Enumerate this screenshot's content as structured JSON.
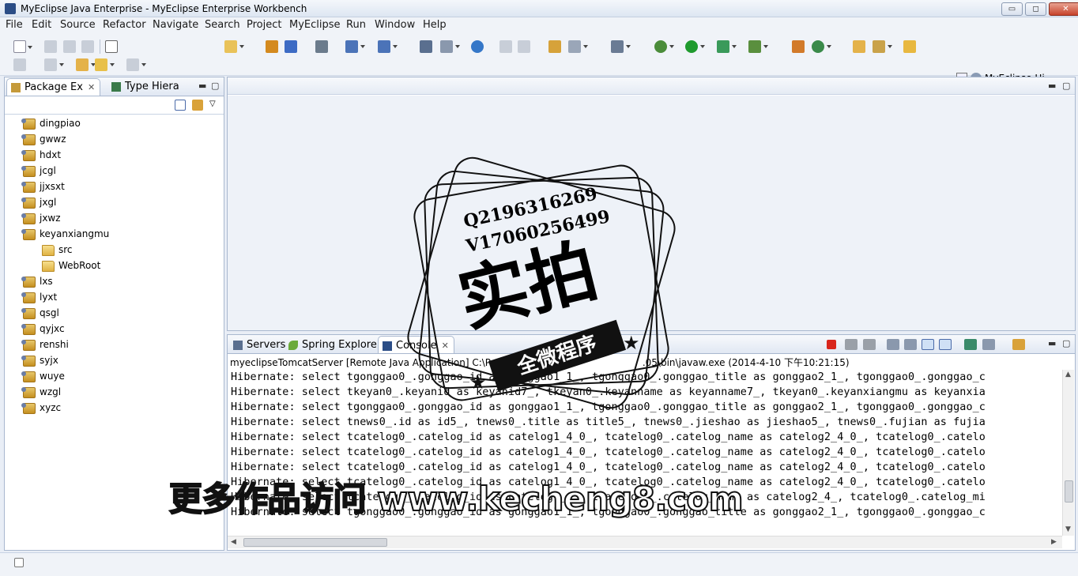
{
  "window": {
    "title": "MyEclipse Java Enterprise - MyEclipse Enterprise Workbench",
    "buttons": {
      "minimize": "▭",
      "maximize": "◻",
      "close": "✕"
    }
  },
  "menu": [
    "File",
    "Edit",
    "Source",
    "Refactor",
    "Navigate",
    "Search",
    "Project",
    "MyEclipse",
    "Run",
    "Window",
    "Help"
  ],
  "perspective": {
    "label": "MyEclipse Hi..."
  },
  "package_explorer": {
    "tab_label": "Package Ex",
    "other_tab_label": "Type Hiera",
    "items": [
      {
        "label": "dingpiao",
        "kind": "project"
      },
      {
        "label": "gwwz",
        "kind": "project"
      },
      {
        "label": "hdxt",
        "kind": "project"
      },
      {
        "label": "jcgl",
        "kind": "project"
      },
      {
        "label": "jjxsxt",
        "kind": "project"
      },
      {
        "label": "jxgl",
        "kind": "project"
      },
      {
        "label": "jxwz",
        "kind": "project"
      },
      {
        "label": "keyanxiangmu",
        "kind": "project"
      },
      {
        "label": "src",
        "kind": "folder"
      },
      {
        "label": "WebRoot",
        "kind": "folder"
      },
      {
        "label": "lxs",
        "kind": "project"
      },
      {
        "label": "lyxt",
        "kind": "project"
      },
      {
        "label": "qsgl",
        "kind": "project"
      },
      {
        "label": "qyjxc",
        "kind": "project"
      },
      {
        "label": "renshi",
        "kind": "project"
      },
      {
        "label": "syjx",
        "kind": "project"
      },
      {
        "label": "wuye",
        "kind": "project"
      },
      {
        "label": "wzgl",
        "kind": "project"
      },
      {
        "label": "xyzc",
        "kind": "project"
      }
    ]
  },
  "console": {
    "tabs": [
      {
        "label": "Servers",
        "icon": "servers-icon"
      },
      {
        "label": "Spring Explorer",
        "icon": "spring-leaf-icon"
      },
      {
        "label": "Console",
        "icon": "console-icon"
      }
    ],
    "launch_info": "myeclipseTomcatServer [Remote Java Application] C:\\Pro",
    "launch_info_tail": ".05\\bin\\javaw.exe (2014-4-10 下午10:21:15)",
    "lines": [
      "Hibernate: select tgonggao0_.gonggao_id as gonggao1_1_, tgonggao0_.gonggao_title as gonggao2_1_, tgonggao0_.gonggao_c",
      "Hibernate: select tkeyan0_.keyanid as keyanid7_, tkeyan0_.keyanname as keyanname7_, tkeyan0_.keyanxiangmu as keyanxia",
      "Hibernate: select tgonggao0_.gonggao_id as gonggao1_1_, tgonggao0_.gonggao_title as gonggao2_1_, tgonggao0_.gonggao_c",
      "Hibernate: select tnews0_.id as id5_, tnews0_.title as title5_, tnews0_.jieshao as jieshao5_, tnews0_.fujian as fujia",
      "Hibernate: select tcatelog0_.catelog_id as catelog1_4_0_, tcatelog0_.catelog_name as catelog2_4_0_, tcatelog0_.catelo",
      "Hibernate: select tcatelog0_.catelog_id as catelog1_4_0_, tcatelog0_.catelog_name as catelog2_4_0_, tcatelog0_.catelo",
      "Hibernate: select tcatelog0_.catelog_id as catelog1_4_0_, tcatelog0_.catelog_name as catelog2_4_0_, tcatelog0_.catelo",
      "Hibernate: select tcatelog0_.catelog_id as catelog1_4_0_, tcatelog0_.catelog_name as catelog2_4_0_, tcatelog0_.catelo",
      "Hibernate: select tcatelog0_.catelog_id as catelog1_4_, tcatelog0_.catelog_name as catelog2_4_, tcatelog0_.catelog_mi",
      "Hibernate: select tgonggao0_.gonggao_id as gonggao1_1_, tgonggao0_.gonggao_title as gonggao2_1_, tgonggao0_.gonggao_c"
    ]
  },
  "watermark": {
    "contact_q": "Q2196316269",
    "contact_v": "V17060256499",
    "big_text": "实拍",
    "ribbon_text": "全微程序",
    "bottom_text": "更多作品访问 www.kecheng8.com"
  },
  "colors": {
    "accent": "#2b4d86",
    "stop_button": "#d9261c",
    "run_button": "#1f9a2e"
  }
}
